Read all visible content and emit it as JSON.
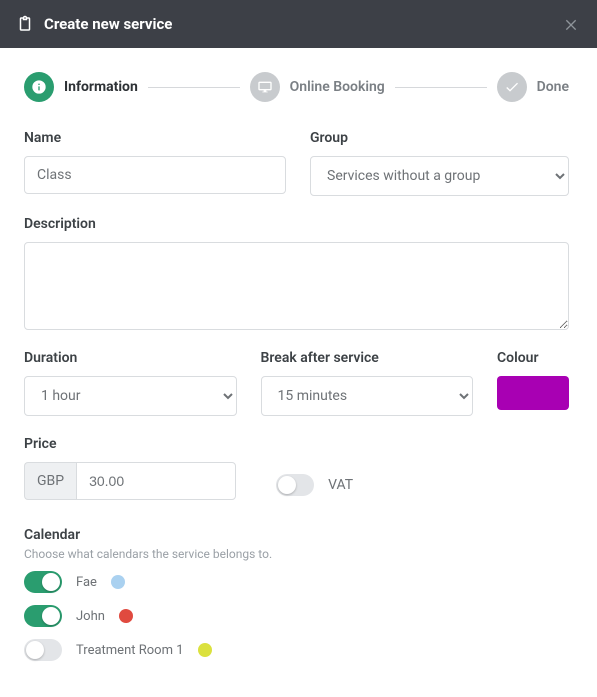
{
  "header": {
    "title": "Create new service"
  },
  "stepper": {
    "steps": [
      {
        "label": "Information"
      },
      {
        "label": "Online Booking"
      },
      {
        "label": "Done"
      }
    ]
  },
  "form": {
    "name": {
      "label": "Name",
      "value": "Class"
    },
    "group": {
      "label": "Group",
      "value": "Services without a group"
    },
    "description": {
      "label": "Description",
      "value": ""
    },
    "duration": {
      "label": "Duration",
      "value": "1 hour"
    },
    "break_after": {
      "label": "Break after service",
      "value": "15 minutes"
    },
    "colour": {
      "label": "Colour",
      "hex": "#a800b3"
    },
    "price": {
      "label": "Price",
      "currency": "GBP",
      "value": "30.00"
    },
    "vat": {
      "label": "VAT",
      "on": false
    }
  },
  "calendar": {
    "label": "Calendar",
    "hint": "Choose what calendars the service belongs to.",
    "items": [
      {
        "name": "Fae",
        "on": true,
        "dot": "#aad1f0"
      },
      {
        "name": "John",
        "on": true,
        "dot": "#e04a3f"
      },
      {
        "name": "Treatment Room 1",
        "on": false,
        "dot": "#dbe13e"
      }
    ]
  }
}
